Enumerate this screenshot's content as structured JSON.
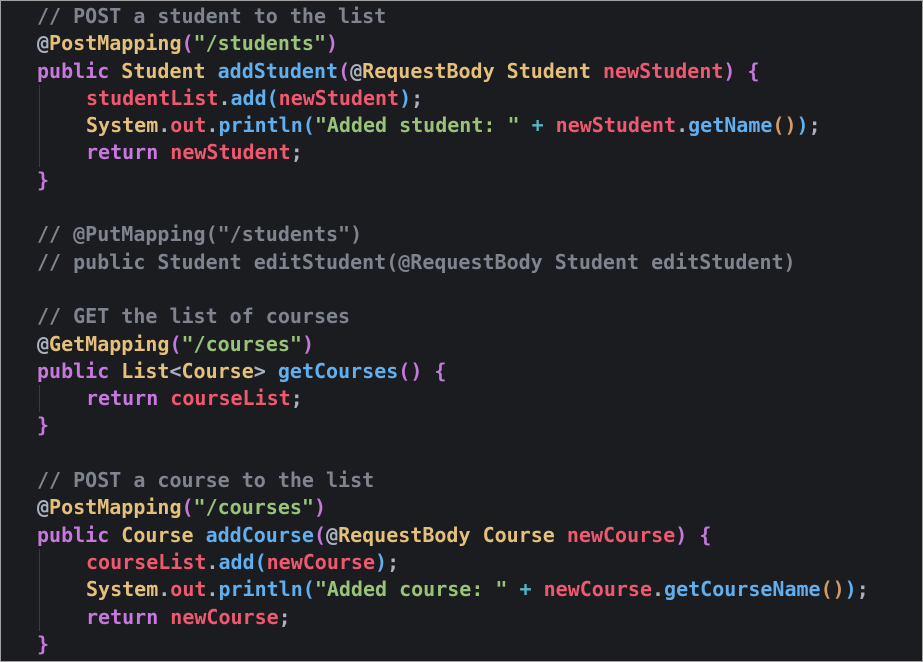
{
  "colors": {
    "background": "#1b1c20",
    "comment": "#7f848e",
    "annotation": "#e5c07b",
    "keyword": "#c678dd",
    "type": "#e5c07b",
    "function": "#61afef",
    "variable": "#ef596f",
    "string": "#98c379",
    "operator": "#56b6c2",
    "punctuation": "#abb2bf",
    "bracket_level_1": "#d19a66",
    "bracket_level_2": "#c678dd",
    "bracket_level_3": "#61afef"
  },
  "code_lines": [
    {
      "indent": 0,
      "tokens": [
        {
          "t": "// POST a student to the list",
          "c": "com"
        }
      ]
    },
    {
      "indent": 0,
      "tokens": [
        {
          "t": "@",
          "c": "at"
        },
        {
          "t": "PostMapping",
          "c": "ann"
        },
        {
          "t": "(",
          "c": "p2"
        },
        {
          "t": "\"/students\"",
          "c": "str"
        },
        {
          "t": ")",
          "c": "p2"
        }
      ]
    },
    {
      "indent": 0,
      "tokens": [
        {
          "t": "public",
          "c": "kw"
        },
        {
          "t": " ",
          "c": "pun"
        },
        {
          "t": "Student",
          "c": "typ"
        },
        {
          "t": " ",
          "c": "pun"
        },
        {
          "t": "addStudent",
          "c": "fn"
        },
        {
          "t": "(",
          "c": "p2"
        },
        {
          "t": "@",
          "c": "at"
        },
        {
          "t": "RequestBody",
          "c": "ann"
        },
        {
          "t": " ",
          "c": "pun"
        },
        {
          "t": "Student",
          "c": "typ"
        },
        {
          "t": " ",
          "c": "pun"
        },
        {
          "t": "newStudent",
          "c": "var"
        },
        {
          "t": ")",
          "c": "p2"
        },
        {
          "t": " ",
          "c": "pun"
        },
        {
          "t": "{",
          "c": "p2"
        }
      ]
    },
    {
      "indent": 1,
      "tokens": [
        {
          "t": "studentList",
          "c": "var"
        },
        {
          "t": ".",
          "c": "pun"
        },
        {
          "t": "add",
          "c": "fn"
        },
        {
          "t": "(",
          "c": "p3"
        },
        {
          "t": "newStudent",
          "c": "var"
        },
        {
          "t": ")",
          "c": "p3"
        },
        {
          "t": ";",
          "c": "pun"
        }
      ]
    },
    {
      "indent": 1,
      "tokens": [
        {
          "t": "System",
          "c": "typ"
        },
        {
          "t": ".",
          "c": "pun"
        },
        {
          "t": "out",
          "c": "var"
        },
        {
          "t": ".",
          "c": "pun"
        },
        {
          "t": "println",
          "c": "fn"
        },
        {
          "t": "(",
          "c": "p3"
        },
        {
          "t": "\"Added student: \"",
          "c": "str"
        },
        {
          "t": " ",
          "c": "pun"
        },
        {
          "t": "+",
          "c": "op"
        },
        {
          "t": " ",
          "c": "pun"
        },
        {
          "t": "newStudent",
          "c": "var"
        },
        {
          "t": ".",
          "c": "pun"
        },
        {
          "t": "getName",
          "c": "fn"
        },
        {
          "t": "()",
          "c": "p1"
        },
        {
          "t": ")",
          "c": "p3"
        },
        {
          "t": ";",
          "c": "pun"
        }
      ]
    },
    {
      "indent": 1,
      "tokens": [
        {
          "t": "return",
          "c": "kw"
        },
        {
          "t": " ",
          "c": "pun"
        },
        {
          "t": "newStudent",
          "c": "var"
        },
        {
          "t": ";",
          "c": "pun"
        }
      ]
    },
    {
      "indent": 0,
      "tokens": [
        {
          "t": "}",
          "c": "p2"
        }
      ]
    },
    {
      "indent": 0,
      "tokens": []
    },
    {
      "indent": 0,
      "tokens": [
        {
          "t": "// @PutMapping(\"/students\")",
          "c": "com"
        }
      ]
    },
    {
      "indent": 0,
      "tokens": [
        {
          "t": "// public Student editStudent(@RequestBody Student editStudent)",
          "c": "com"
        }
      ]
    },
    {
      "indent": 0,
      "tokens": []
    },
    {
      "indent": 0,
      "tokens": [
        {
          "t": "// GET the list of courses",
          "c": "com"
        }
      ]
    },
    {
      "indent": 0,
      "tokens": [
        {
          "t": "@",
          "c": "at"
        },
        {
          "t": "GetMapping",
          "c": "ann"
        },
        {
          "t": "(",
          "c": "p2"
        },
        {
          "t": "\"/courses\"",
          "c": "str"
        },
        {
          "t": ")",
          "c": "p2"
        }
      ]
    },
    {
      "indent": 0,
      "tokens": [
        {
          "t": "public",
          "c": "kw"
        },
        {
          "t": " ",
          "c": "pun"
        },
        {
          "t": "List",
          "c": "typ"
        },
        {
          "t": "<",
          "c": "pun"
        },
        {
          "t": "Course",
          "c": "typ"
        },
        {
          "t": ">",
          "c": "pun"
        },
        {
          "t": " ",
          "c": "pun"
        },
        {
          "t": "getCourses",
          "c": "fn"
        },
        {
          "t": "()",
          "c": "p2"
        },
        {
          "t": " ",
          "c": "pun"
        },
        {
          "t": "{",
          "c": "p2"
        }
      ]
    },
    {
      "indent": 1,
      "tokens": [
        {
          "t": "return",
          "c": "kw"
        },
        {
          "t": " ",
          "c": "pun"
        },
        {
          "t": "courseList",
          "c": "var"
        },
        {
          "t": ";",
          "c": "pun"
        }
      ]
    },
    {
      "indent": 0,
      "tokens": [
        {
          "t": "}",
          "c": "p2"
        }
      ]
    },
    {
      "indent": 0,
      "tokens": []
    },
    {
      "indent": 0,
      "tokens": [
        {
          "t": "// POST a course to the list",
          "c": "com"
        }
      ]
    },
    {
      "indent": 0,
      "tokens": [
        {
          "t": "@",
          "c": "at"
        },
        {
          "t": "PostMapping",
          "c": "ann"
        },
        {
          "t": "(",
          "c": "p2"
        },
        {
          "t": "\"/courses\"",
          "c": "str"
        },
        {
          "t": ")",
          "c": "p2"
        }
      ]
    },
    {
      "indent": 0,
      "tokens": [
        {
          "t": "public",
          "c": "kw"
        },
        {
          "t": " ",
          "c": "pun"
        },
        {
          "t": "Course",
          "c": "typ"
        },
        {
          "t": " ",
          "c": "pun"
        },
        {
          "t": "addCourse",
          "c": "fn"
        },
        {
          "t": "(",
          "c": "p2"
        },
        {
          "t": "@",
          "c": "at"
        },
        {
          "t": "RequestBody",
          "c": "ann"
        },
        {
          "t": " ",
          "c": "pun"
        },
        {
          "t": "Course",
          "c": "typ"
        },
        {
          "t": " ",
          "c": "pun"
        },
        {
          "t": "newCourse",
          "c": "var"
        },
        {
          "t": ")",
          "c": "p2"
        },
        {
          "t": " ",
          "c": "pun"
        },
        {
          "t": "{",
          "c": "p2"
        }
      ]
    },
    {
      "indent": 1,
      "tokens": [
        {
          "t": "courseList",
          "c": "var"
        },
        {
          "t": ".",
          "c": "pun"
        },
        {
          "t": "add",
          "c": "fn"
        },
        {
          "t": "(",
          "c": "p3"
        },
        {
          "t": "newCourse",
          "c": "var"
        },
        {
          "t": ")",
          "c": "p3"
        },
        {
          "t": ";",
          "c": "pun"
        }
      ]
    },
    {
      "indent": 1,
      "tokens": [
        {
          "t": "System",
          "c": "typ"
        },
        {
          "t": ".",
          "c": "pun"
        },
        {
          "t": "out",
          "c": "var"
        },
        {
          "t": ".",
          "c": "pun"
        },
        {
          "t": "println",
          "c": "fn"
        },
        {
          "t": "(",
          "c": "p3"
        },
        {
          "t": "\"Added course: \"",
          "c": "str"
        },
        {
          "t": " ",
          "c": "pun"
        },
        {
          "t": "+",
          "c": "op"
        },
        {
          "t": " ",
          "c": "pun"
        },
        {
          "t": "newCourse",
          "c": "var"
        },
        {
          "t": ".",
          "c": "pun"
        },
        {
          "t": "getCourseName",
          "c": "fn"
        },
        {
          "t": "()",
          "c": "p1"
        },
        {
          "t": ")",
          "c": "p3"
        },
        {
          "t": ";",
          "c": "pun"
        }
      ]
    },
    {
      "indent": 1,
      "tokens": [
        {
          "t": "return",
          "c": "kw"
        },
        {
          "t": " ",
          "c": "pun"
        },
        {
          "t": "newCourse",
          "c": "var"
        },
        {
          "t": ";",
          "c": "pun"
        }
      ]
    },
    {
      "indent": 0,
      "tokens": [
        {
          "t": "}",
          "c": "p2"
        }
      ]
    }
  ]
}
